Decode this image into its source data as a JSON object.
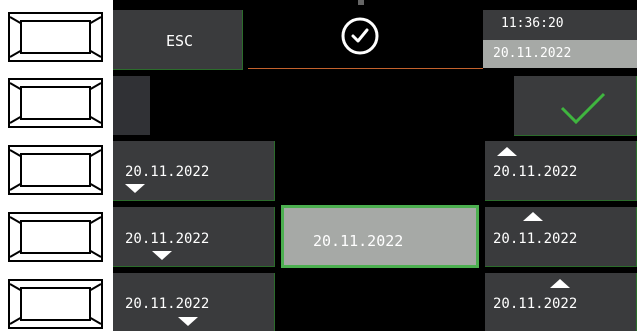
{
  "header": {
    "esc_label": "ESC",
    "time": "11:36:20",
    "date": "20.11.2022",
    "clock_icon": "clock-icon"
  },
  "confirm": {
    "icon": "checkmark-icon",
    "color": "#3fb53f"
  },
  "left_column": [
    {
      "label": "20.11.2022",
      "arrow": "down"
    },
    {
      "label": "20.11.2022",
      "arrow": "down"
    },
    {
      "label": "20.11.2022",
      "arrow": "down"
    }
  ],
  "center_value": "20.11.2022",
  "right_column": [
    {
      "label": "20.11.2022",
      "arrow": "up"
    },
    {
      "label": "20.11.2022",
      "arrow": "up"
    },
    {
      "label": "20.11.2022",
      "arrow": "up"
    }
  ],
  "colors": {
    "panel": "#3a3b3d",
    "accent_green": "#4caf50",
    "selected_bg": "#a6a9a6",
    "divider_orange": "#c4622d"
  }
}
